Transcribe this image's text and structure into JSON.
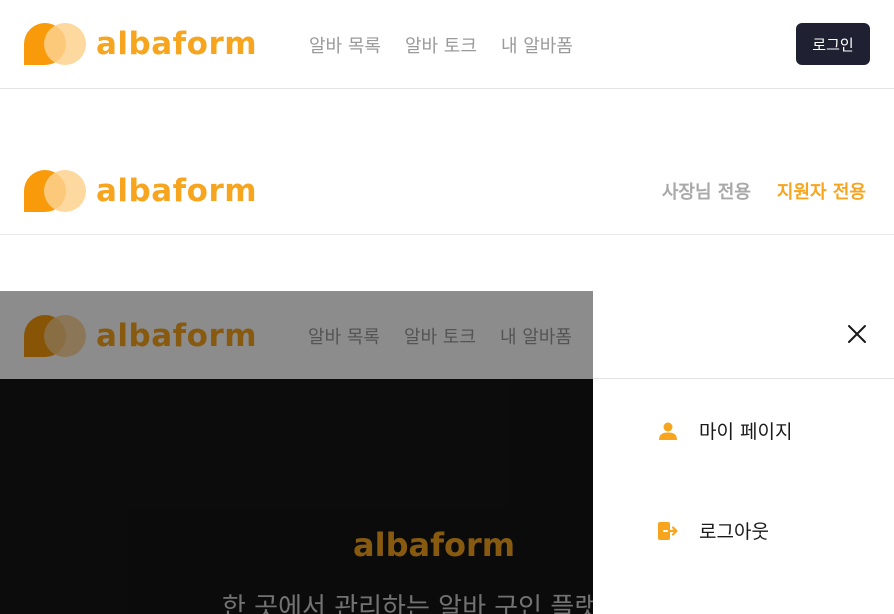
{
  "brand": {
    "name": "albaform",
    "color": "#f7a51e",
    "mark_color": "#f89a0a",
    "mark_light_color": "#fdd18e"
  },
  "header_main": {
    "nav": [
      "알바 목록",
      "알바 토크",
      "내 알바폼"
    ],
    "login_label": "로그인"
  },
  "header_role": {
    "tabs": [
      {
        "label": "사장님 전용",
        "active": false
      },
      {
        "label": "지원자 전용",
        "active": true
      }
    ]
  },
  "drawer_view": {
    "nav": [
      "알바 목록",
      "알바 토크",
      "내 알바폼"
    ],
    "close_icon": "close-icon",
    "items": [
      {
        "label": "마이 페이지",
        "icon": "user-icon"
      },
      {
        "label": "로그아웃",
        "icon": "logout-icon"
      }
    ],
    "hero": {
      "logo": "albaform",
      "subtitle": "한 곳에서 관리하는 알바 구인 플랫폼"
    }
  }
}
